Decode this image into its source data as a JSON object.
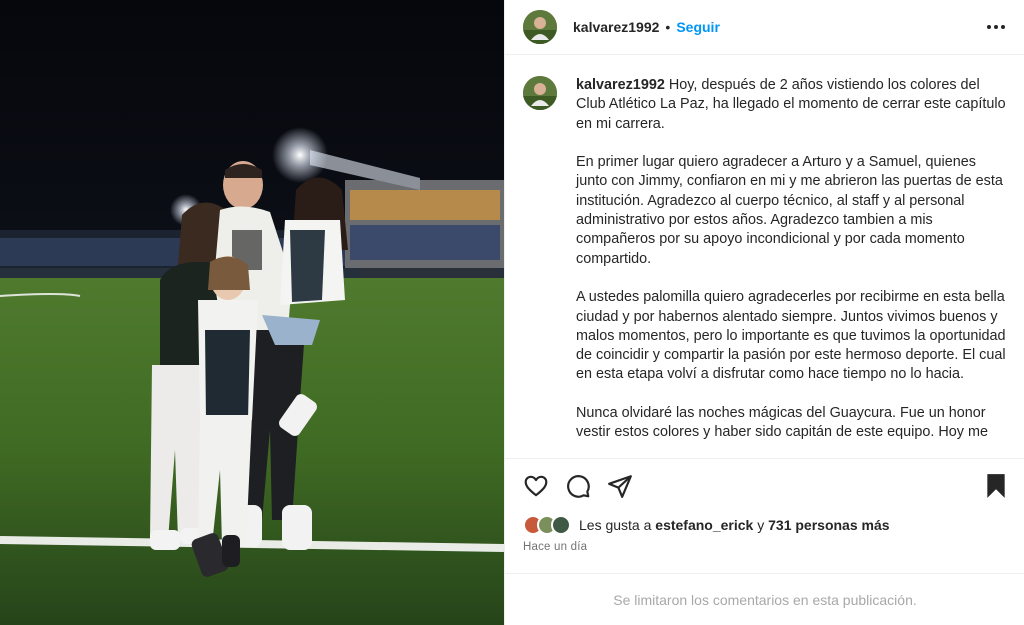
{
  "post": {
    "username": "kalvarez1992",
    "separator": "•",
    "follow_label": "Seguir",
    "more_icon": "more-horizontal-icon"
  },
  "caption": {
    "username": "kalvarez1992",
    "paragraphs": [
      "Hoy, después de 2 años vistiendo los colores del Club Atlético La Paz, ha llegado el momento de cerrar este capítulo en mi carrera.",
      "En primer lugar quiero agradecer a Arturo y a Samuel, quienes junto con Jimmy, confiaron en mi y me abrieron las puertas de esta institución. Agradezco al cuerpo técnico, al staff y al personal administrativo por estos años. Agradezco tambien a mis compañeros por su apoyo incondicional y por cada momento compartido.",
      "A ustedes palomilla quiero agradecerles por recibirme en esta bella ciudad y por habernos alentado siempre. Juntos vivimos buenos y malos momentos, pero lo importante es que tuvimos la oportunidad de coincidir y compartir la pasión por este hermoso deporte. El cual en esta etapa volví a disfrutar como hace tiempo no lo hacia.",
      "Nunca olvidaré las noches mágicas del Guaycura. Fue un honor vestir estos colores y haber sido capitán de este equipo. Hoy me"
    ]
  },
  "actions": {
    "like_icon": "heart-icon",
    "comment_icon": "comment-icon",
    "share_icon": "paper-plane-icon",
    "save_icon": "bookmark-icon"
  },
  "likes": {
    "prefix": "Les gusta a",
    "first_user": "estefano_erick",
    "connector": "y",
    "others": "731 personas más",
    "avatar_colors": [
      "#c65a3a",
      "#7a8f5a",
      "#3f5a44"
    ]
  },
  "timestamp": "Hace un día",
  "comments_notice": "Se limitaron los comentarios en esta publicación.",
  "colors": {
    "accent": "#0095f6",
    "text": "#262626",
    "muted": "#737373",
    "border": "#efefef"
  }
}
